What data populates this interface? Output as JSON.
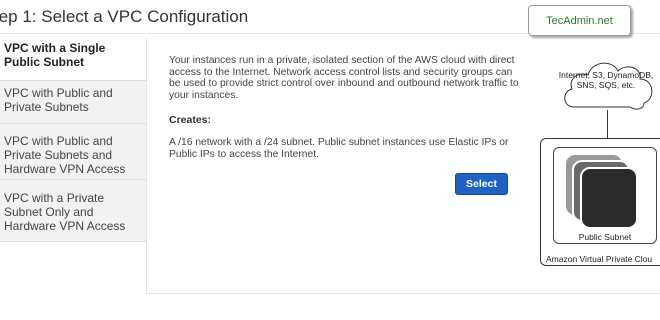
{
  "page": {
    "title": "tep 1: Select a VPC Configuration"
  },
  "sidebar": {
    "items": [
      {
        "label": "VPC with a Single Public Subnet",
        "active": true
      },
      {
        "label": "VPC with Public and Private Subnets",
        "active": false
      },
      {
        "label": "VPC with Public and Private Subnets and Hardware VPN Access",
        "active": false
      },
      {
        "label": "VPC with a Private Subnet Only and Hardware VPN Access",
        "active": false
      }
    ]
  },
  "content": {
    "description": "Your instances run in a private, isolated section of the AWS cloud with direct access to the Internet. Network access control lists and security groups can be used to provide strict control over inbound and outbound network traffic to your instances.",
    "creates_label": "Creates:",
    "creates_text": "A /16 network with a /24 subnet. Public subnet instances use Elastic IPs or Public IPs to access the Internet.",
    "select_button": "Select"
  },
  "watermark": "TecAdmin.net",
  "diagram": {
    "cloud_text": "Internet, S3, DynamoDB, SNS, SQS, etc.",
    "subnet_label": "Public Subnet",
    "vpc_label": "Amazon Virtual Private Clou"
  },
  "colors": {
    "accent": "#1f62c4",
    "sidebar_bg": "#f2f2f2",
    "watermark_text": "#2a7a2a"
  }
}
